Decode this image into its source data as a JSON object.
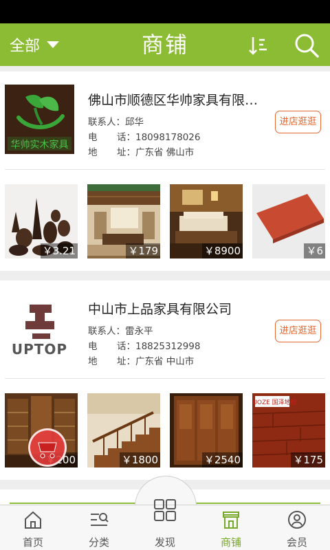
{
  "header": {
    "filter_label": "全部",
    "title": "商铺",
    "background": "#8cbb34"
  },
  "shops": [
    {
      "name": "佛山市顺德区华帅家具有限公...",
      "contact_label": "联系人：",
      "contact": "邱华",
      "phone_label_1": "电",
      "phone_label_2": "话：",
      "phone": "18098178026",
      "address_label_1": "地",
      "address_label_2": "址：",
      "address": "广东省 佛山市",
      "visit_label": "进店逛逛",
      "logo_text": "华帅实木家具",
      "products": [
        {
          "price": "￥3.21",
          "icon": "wood-carving"
        },
        {
          "price": "￥179",
          "icon": "wood-ceiling-room"
        },
        {
          "price": "￥8900",
          "icon": "hotel-bedroom"
        },
        {
          "price": "￥6",
          "icon": "red-wood-board"
        }
      ]
    },
    {
      "name": "中山市上品家具有限公司",
      "contact_label": "联系人：",
      "contact": "雷永平",
      "phone_label_1": "电",
      "phone_label_2": "话：",
      "phone": "18825312998",
      "address_label_1": "地",
      "address_label_2": "址：",
      "address": "广东省 中山市",
      "visit_label": "进店逛逛",
      "logo_text": "UPTOP",
      "products": [
        {
          "price": "￥200",
          "icon": "wine-cabinet"
        },
        {
          "price": "￥1800",
          "icon": "wooden-staircase"
        },
        {
          "price": "￥2540",
          "icon": "wardrobe"
        },
        {
          "price": "￥175",
          "icon": "wood-flooring",
          "brand": "GUOZE 国泽地板"
        }
      ]
    }
  ],
  "tabbar": {
    "items": [
      {
        "label": "首页",
        "icon": "home-icon"
      },
      {
        "label": "分类",
        "icon": "category-icon"
      },
      {
        "label": "发现",
        "icon": "grid-icon"
      },
      {
        "label": "商铺",
        "icon": "shop-icon",
        "active": true
      },
      {
        "label": "会员",
        "icon": "user-icon"
      }
    ],
    "active_color": "#78a82a"
  },
  "accent_orange": "#e8652c"
}
